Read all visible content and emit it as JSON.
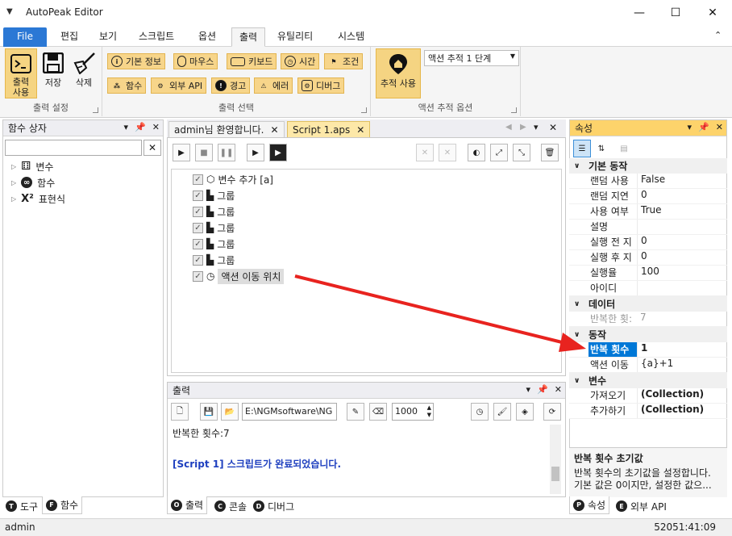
{
  "window": {
    "title": "AutoPeak Editor"
  },
  "menu": {
    "tabs": [
      "File",
      "편집",
      "보기",
      "스크립트",
      "옵션",
      "출력",
      "유틸리티",
      "시스템"
    ]
  },
  "ribbon": {
    "output_settings": {
      "label": "출력 설정",
      "btn_output": "출력\n사용",
      "btn_save": "저장",
      "btn_delete": "삭제"
    },
    "output_select": {
      "label": "출력 선택",
      "buttons": [
        "기본 정보",
        "마우스",
        "키보드",
        "시간",
        "조건",
        "함수",
        "외부 API",
        "경고",
        "에러",
        "디버그"
      ]
    },
    "action_track": {
      "label": "액션 추적 옵션",
      "btn_track": "추적 사용",
      "combo_value": "액션 추적 1 단계"
    }
  },
  "function_panel": {
    "title": "함수 상자",
    "search_value": "",
    "items": [
      "변수",
      "함수",
      "표현식"
    ],
    "tabs": [
      "도구",
      "함수"
    ]
  },
  "doc": {
    "tabs": [
      "admin님 환영합니다.",
      "Script 1.aps"
    ]
  },
  "script": {
    "rows": [
      {
        "label": "변수 추가 [a]"
      },
      {
        "label": "그룹"
      },
      {
        "label": "그룹"
      },
      {
        "label": "그룹"
      },
      {
        "label": "그룹"
      },
      {
        "label": "그룹"
      },
      {
        "label": "액션 이동 위치"
      }
    ]
  },
  "output_panel": {
    "title": "출력",
    "path": "E:\\NGMsoftware\\NG",
    "count": "1000",
    "lines": [
      "반복한 횟수:7",
      "[Script 1] 스크립트가 완료되었습니다."
    ],
    "tabs": [
      "출력",
      "콘솔",
      "디버그"
    ]
  },
  "properties": {
    "title": "속성",
    "cats": {
      "basic": "기본 동작",
      "data": "데이터",
      "action": "동작",
      "var": "변수"
    },
    "basic_rows": [
      {
        "name": "랜덤 사용",
        "value": "False"
      },
      {
        "name": "랜덤 지연",
        "value": "0"
      },
      {
        "name": "사용 여부",
        "value": "True"
      },
      {
        "name": "설명",
        "value": ""
      },
      {
        "name": "실행 전 지",
        "value": "0"
      },
      {
        "name": "실행 후 지",
        "value": "0"
      },
      {
        "name": "실행율",
        "value": "100"
      },
      {
        "name": "아이디",
        "value": ""
      }
    ],
    "data_rows": [
      {
        "name": "반복한 횟:",
        "value": "7"
      }
    ],
    "action_rows": [
      {
        "name": "반복 횟수",
        "value": "1"
      },
      {
        "name": "액션 이동",
        "value": "{a}+1"
      }
    ],
    "var_rows": [
      {
        "name": "가져오기",
        "value": "(Collection)"
      },
      {
        "name": "추가하기",
        "value": "(Collection)"
      }
    ],
    "desc_title": "반복 횟수 초기값",
    "desc_text": "반복 횟수의 초기값을 설정합니다. 기본 값은 0이지만, 설정한 값으...",
    "tabs": [
      "속성",
      "외부 API"
    ]
  },
  "status": {
    "user": "admin",
    "time": "52051:41:09"
  },
  "colors": {
    "accent": "#2b78d5",
    "ribbon_btn": "#f7d58a",
    "arrow": "#e8231f",
    "selected": "#0078d7"
  }
}
